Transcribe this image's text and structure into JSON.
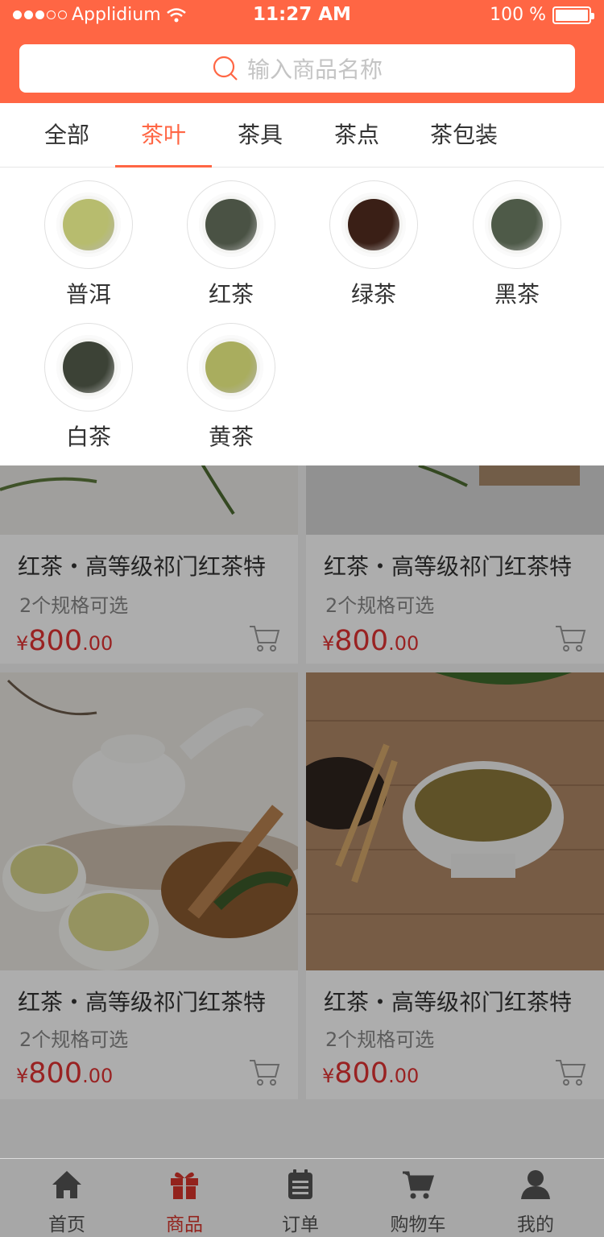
{
  "status_bar": {
    "carrier": "Applidium",
    "time": "11:27 AM",
    "battery": "100 %",
    "battery_level": 1.0
  },
  "search": {
    "placeholder": "输入商品名称"
  },
  "tabs": [
    {
      "label": "全部"
    },
    {
      "label": "茶叶",
      "active": true
    },
    {
      "label": "茶具"
    },
    {
      "label": "茶点"
    },
    {
      "label": "茶包装"
    }
  ],
  "subcategories": [
    {
      "label": "普洱",
      "leaf_color": "#b7bc6e"
    },
    {
      "label": "红茶",
      "leaf_color": "#4a5244"
    },
    {
      "label": "绿茶",
      "leaf_color": "#3a1f16"
    },
    {
      "label": "黑茶",
      "leaf_color": "#4e5a48"
    },
    {
      "label": "白茶",
      "leaf_color": "#3c4236"
    },
    {
      "label": "黄茶",
      "leaf_color": "#a9ad5e"
    }
  ],
  "products": [
    {
      "title": "红茶・高等级祁门红茶特",
      "spec": "2个规格可选",
      "currency": "¥",
      "price_int": "800",
      "price_dec": ".00"
    },
    {
      "title": "红茶・高等级祁门红茶特",
      "spec": "2个规格可选",
      "currency": "¥",
      "price_int": "800",
      "price_dec": ".00"
    },
    {
      "title": "红茶・高等级祁门红茶特",
      "spec": "2个规格可选",
      "currency": "¥",
      "price_int": "800",
      "price_dec": ".00"
    },
    {
      "title": "红茶・高等级祁门红茶特",
      "spec": "2个规格可选",
      "currency": "¥",
      "price_int": "800",
      "price_dec": ".00"
    }
  ],
  "tabbar": [
    {
      "label": "首页",
      "icon": "home-icon"
    },
    {
      "label": "商品",
      "icon": "gift-icon",
      "active": true
    },
    {
      "label": "订单",
      "icon": "clipboard-icon"
    },
    {
      "label": "购物车",
      "icon": "cart-icon"
    },
    {
      "label": "我的",
      "icon": "user-icon"
    }
  ],
  "colors": {
    "accent": "#ff6644",
    "price": "#e23333",
    "active_tab": "#d9342b"
  }
}
